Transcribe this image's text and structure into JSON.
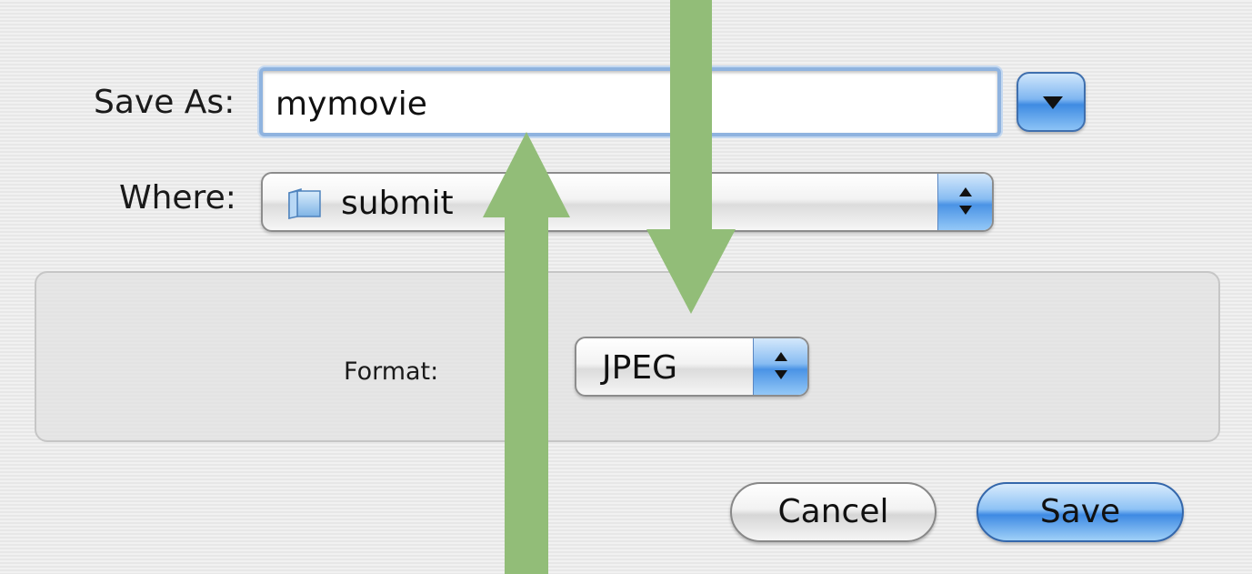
{
  "dialog": {
    "save_as_label": "Save As:",
    "filename_value": "mymovie",
    "where_label": "Where:",
    "where_value": "submit",
    "format_label": "Format:",
    "format_value": "JPEG",
    "cancel_label": "Cancel",
    "save_label": "Save"
  },
  "colors": {
    "annotation_arrow": "#92bd78",
    "default_button_blue": "#3e8ae3"
  },
  "icons": {
    "where_popup_icon": "folder-icon",
    "expand_button_icon": "triangle-down-icon",
    "popup_stepper_icon": "up-down-arrows-icon"
  }
}
